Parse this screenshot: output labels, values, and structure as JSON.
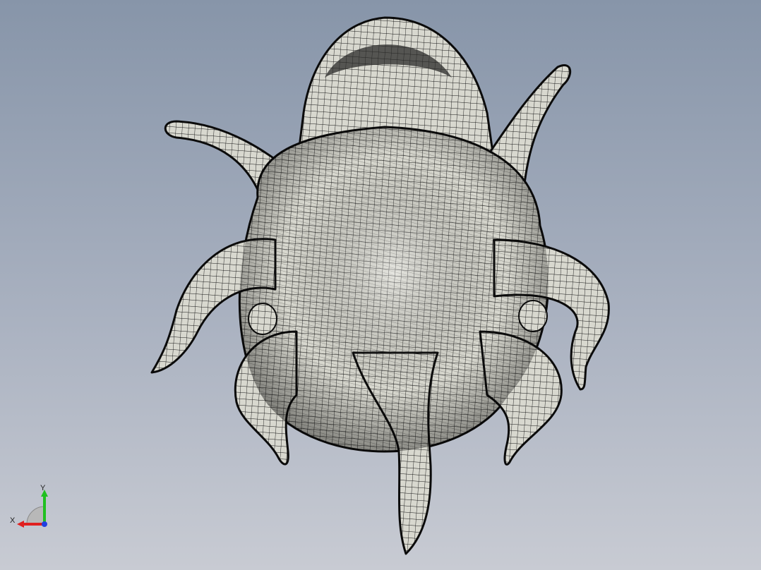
{
  "viewport": {
    "background_top": "#8795a9",
    "background_bottom": "#c8cbd3"
  },
  "model": {
    "render_mode": "shaded-with-mesh-edges",
    "mesh_color": "#111111",
    "surface_color": "#d8d8cf"
  },
  "triad": {
    "x_label": "X",
    "y_label": "Y",
    "x_color": "#e02020",
    "y_color": "#20c020",
    "z_color": "#2040e0"
  }
}
